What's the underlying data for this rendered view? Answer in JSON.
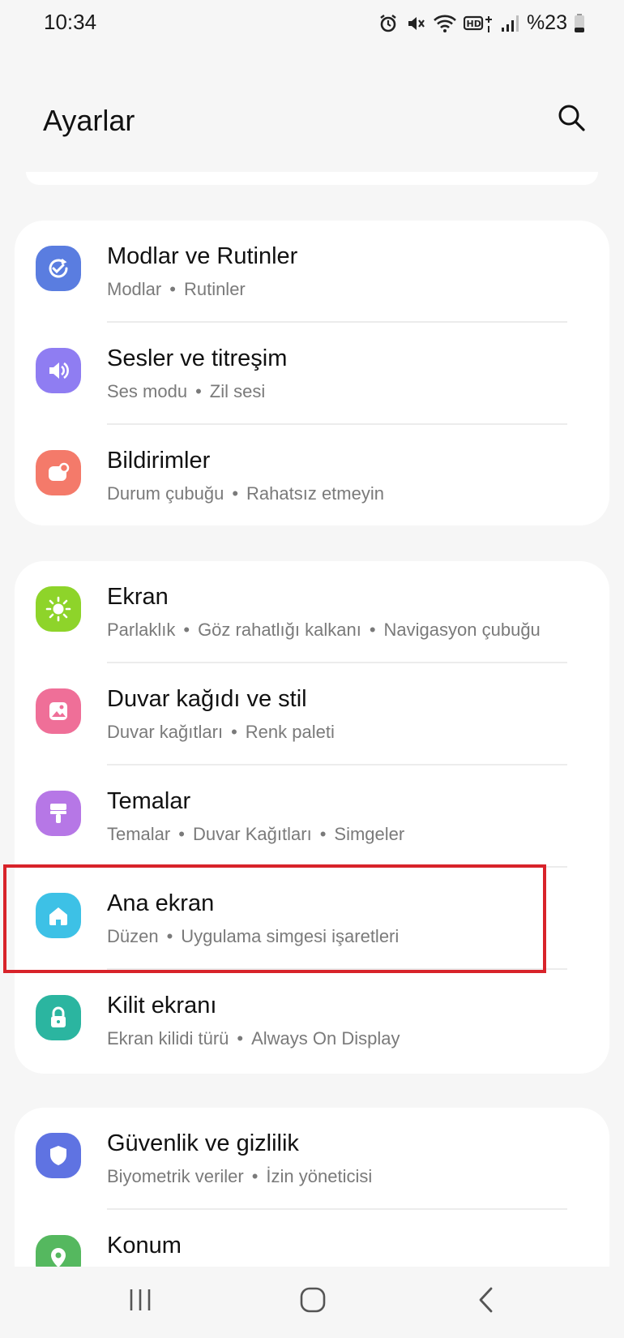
{
  "status_bar": {
    "time": "10:34",
    "battery": "%23",
    "icons": [
      "alarm-icon",
      "mute-icon",
      "wifi-icon",
      "hd-plus-icon",
      "signal-icon",
      "battery-icon"
    ]
  },
  "header": {
    "title": "Ayarlar",
    "search_icon": "search-icon"
  },
  "groups": [
    {
      "items": [
        {
          "label": "Modlar ve Rutinler",
          "sub": [
            "Modlar",
            "Rutinler"
          ],
          "icon": "modes-routines-icon",
          "color": "#5a7de0"
        },
        {
          "label": "Sesler ve titreşim",
          "sub": [
            "Ses modu",
            "Zil sesi"
          ],
          "icon": "sound-icon",
          "color": "#8f7df2"
        },
        {
          "label": "Bildirimler",
          "sub": [
            "Durum çubuğu",
            "Rahatsız etmeyin"
          ],
          "icon": "notifications-icon",
          "color": "#f47a6a"
        }
      ]
    },
    {
      "items": [
        {
          "label": "Ekran",
          "sub": [
            "Parlaklık",
            "Göz rahatlığı kalkanı",
            "Navigasyon çubuğu"
          ],
          "icon": "display-sun-icon",
          "color": "#8ed42a"
        },
        {
          "label": "Duvar kağıdı ve stil",
          "sub": [
            "Duvar kağıtları",
            "Renk paleti"
          ],
          "icon": "wallpaper-icon",
          "color": "#ef6f98"
        },
        {
          "label": "Temalar",
          "sub": [
            "Temalar",
            "Duvar Kağıtları",
            "Simgeler"
          ],
          "icon": "themes-brush-icon",
          "color": "#b677e6"
        },
        {
          "label": "Ana ekran",
          "sub": [
            "Düzen",
            "Uygulama simgesi işaretleri"
          ],
          "icon": "home-icon",
          "color": "#3dc1e6"
        },
        {
          "label": "Kilit ekranı",
          "sub": [
            "Ekran kilidi türü",
            "Always On Display"
          ],
          "icon": "lock-icon",
          "color": "#2bb5a0"
        }
      ]
    },
    {
      "items": [
        {
          "label": "Güvenlik ve gizlilik",
          "sub": [
            "Biyometrik veriler",
            "İzin yöneticisi"
          ],
          "icon": "shield-icon",
          "color": "#5f73e2"
        },
        {
          "label": "Konum",
          "sub": [],
          "icon": "location-icon",
          "color": "#55b85f"
        }
      ]
    }
  ],
  "highlight": {
    "target": "Ana ekran",
    "color": "#d8232a"
  },
  "nav_bar": {
    "recents": "recents-icon",
    "home": "home-button-icon",
    "back": "back-icon"
  }
}
